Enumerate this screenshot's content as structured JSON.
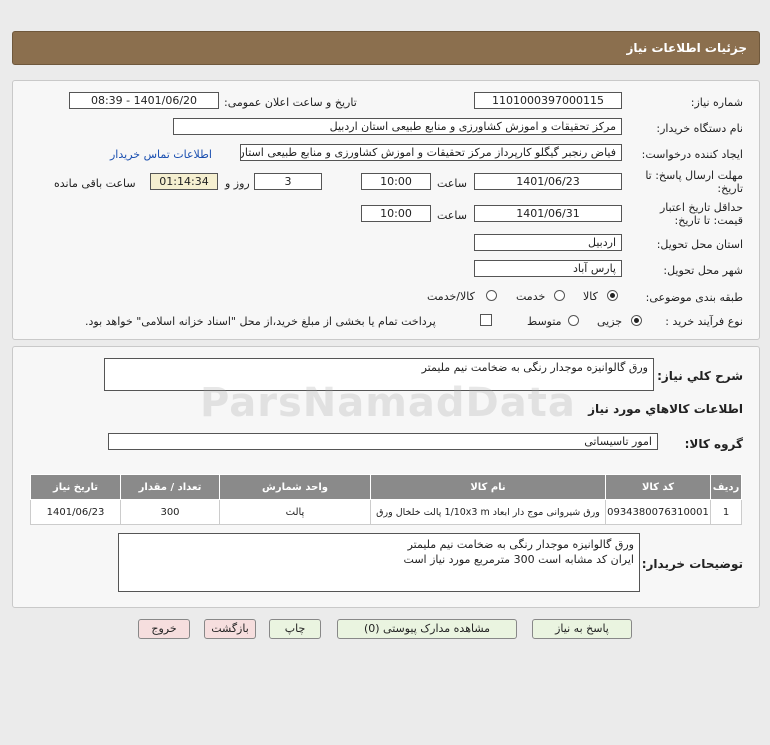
{
  "header": {
    "title": "جزئیات اطلاعات نیاز"
  },
  "fields": {
    "need_number_label": "شماره نیاز:",
    "need_number": "1101000397000115",
    "announce_label": "تاریخ و ساعت اعلان عمومی:",
    "announce_value": "1401/06/20 - 08:39",
    "buyer_label": "نام دستگاه خریدار:",
    "buyer": "مرکز تحقیقات و اموزش کشاورزی و منابع طبیعی استان اردبیل",
    "creator_label": "ایجاد کننده درخواست:",
    "creator": "فیاض رنجبر گیگلو کارپرداز مرکز تحقیقات و اموزش کشاورزی و منابع طبیعی استان",
    "contact_link": "اطلاعات تماس خریدار",
    "deadline_label_1": "مهلت ارسال پاسخ: تا",
    "deadline_label_2": "تاریخ:",
    "deadline_date": "1401/06/23",
    "time_label": "ساعت",
    "deadline_time": "10:00",
    "days": "3",
    "days_label": "روز و",
    "remaining": "01:14:34",
    "remaining_label": "ساعت باقی مانده",
    "validity_label_1": "حداقل تاریخ اعتبار",
    "validity_label_2": "قیمت: تا تاریخ:",
    "validity_date": "1401/06/31",
    "validity_time": "10:00",
    "province_label": "استان محل تحویل:",
    "province": "اردبیل",
    "city_label": "شهر محل تحویل:",
    "city": "پارس آباد",
    "category_label": "طبقه بندی موضوعی:",
    "category_options": [
      "کالا",
      "خدمت",
      "کالا/خدمت"
    ],
    "process_label": "نوع فرآیند خرید :",
    "process_options": [
      "جزیی",
      "متوسط"
    ],
    "payment_note": "پرداخت تمام یا بخشی از مبلغ خرید،از محل \"اسناد خزانه اسلامی\" خواهد بود."
  },
  "summary": {
    "label": "شرح کلي نياز:",
    "value": "ورق گالوانیزه موجدار رنگی به ضخامت نیم ملیمتر"
  },
  "goods": {
    "section_title": "اطلاعات کالاهاي مورد نياز",
    "group_label": "گروه کالا:",
    "group_value": "امور تاسیساتی",
    "columns": [
      "ردیف",
      "کد کالا",
      "نام کالا",
      "واحد شمارش",
      "تعداد / مقدار",
      "تاریخ نیاز"
    ],
    "rows": [
      [
        "1",
        "0934380076310001",
        "ورق شیروانی موج دار ابعاد 1/10x3 m پالت خلخال ورق",
        "پالت",
        "300",
        "1401/06/23"
      ]
    ]
  },
  "buyer_notes": {
    "label": "توضیحات خریدار:",
    "line1": "ورق گالوانیزه موجدار رنگی به ضخامت نیم ملیمتر",
    "line2": "ایران کد مشابه است 300 مترمربع مورد نیاز است"
  },
  "buttons": {
    "reply": "پاسخ به نیاز",
    "attachments": "مشاهده مدارک پیوستی (0)",
    "print": "چاپ",
    "back": "بازگشت",
    "exit": "خروج"
  }
}
